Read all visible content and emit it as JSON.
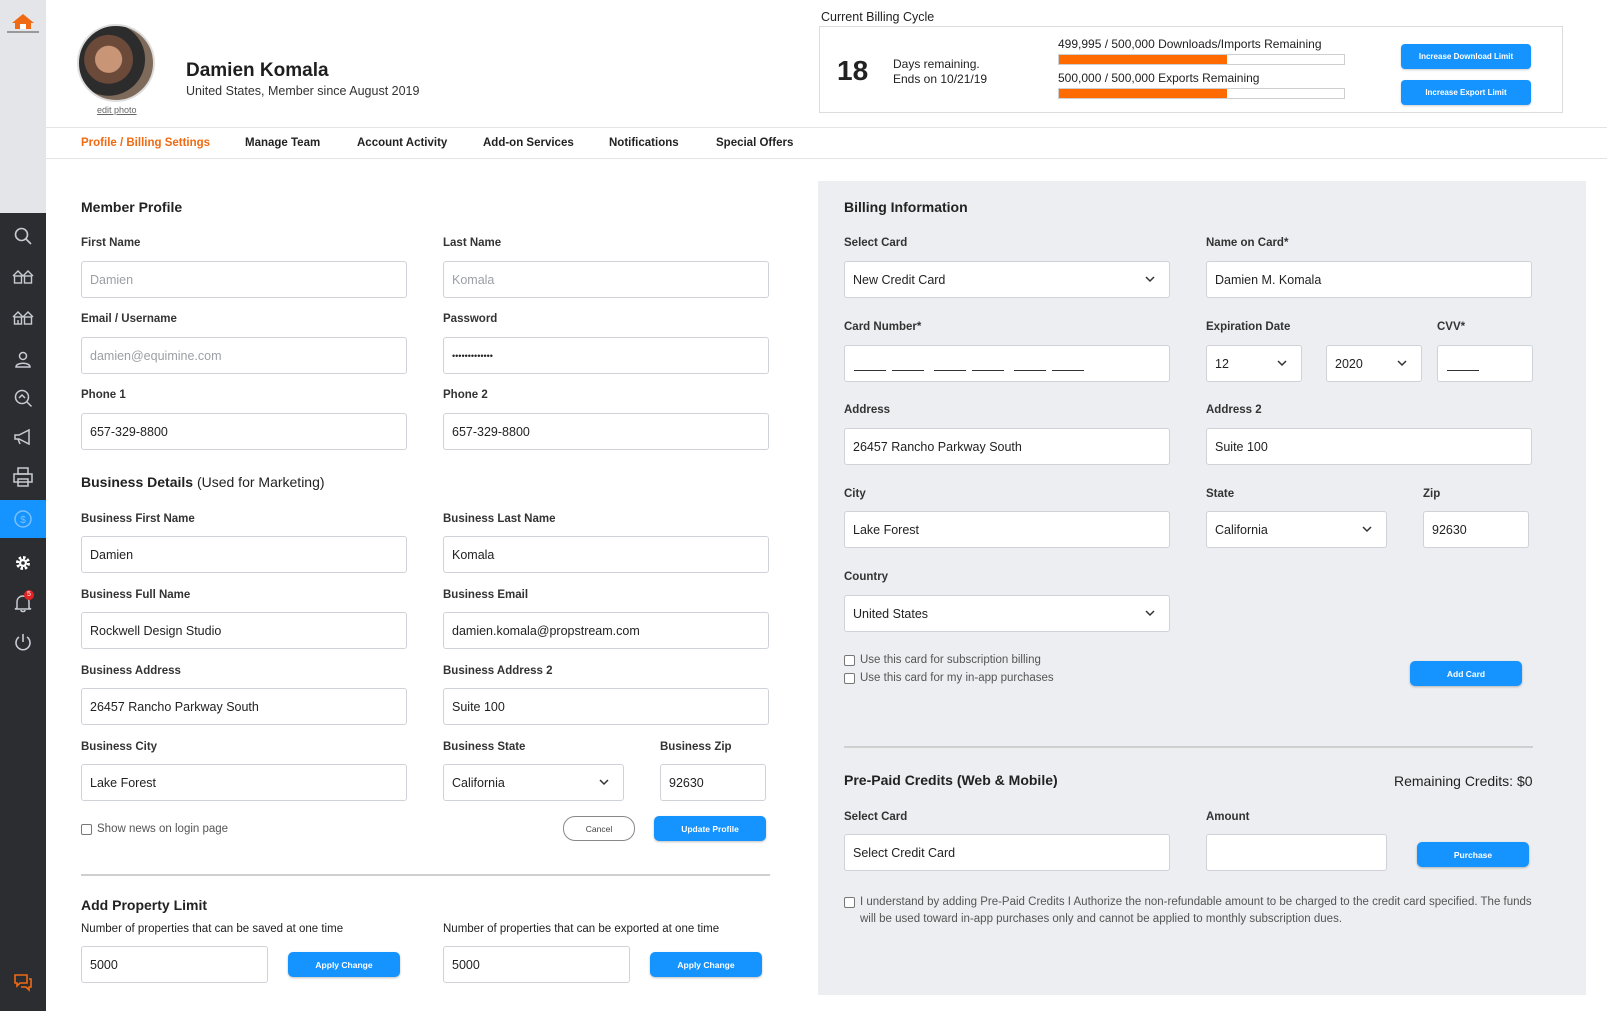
{
  "sidebar": {
    "icons": [
      "search-icon",
      "houses-icon",
      "houses-alt-icon",
      "user-icon",
      "search-property-icon",
      "megaphone-icon",
      "print-icon",
      "billing-icon",
      "gear-icon",
      "bell-icon",
      "power-icon",
      "chat-icon"
    ],
    "notification_count": "5"
  },
  "profile": {
    "name": "Damien Komala",
    "subtitle": "United States, Member since August 2019",
    "edit_photo": "edit photo"
  },
  "billing_cycle": {
    "title": "Current Billing Cycle",
    "days": "18",
    "days_line1": "Days remaining.",
    "days_line2": "Ends on 10/21/19",
    "downloads_label": "499,995 / 500,000 Downloads/Imports Remaining",
    "downloads_fraction": 0.59,
    "exports_label": "500,000 / 500,000 Exports Remaining",
    "exports_fraction": 0.59,
    "increase_download": "Increase Download Limit",
    "increase_export": "Increase Export Limit"
  },
  "tabs": [
    "Profile / Billing Settings",
    "Manage Team",
    "Account Activity",
    "Add-on Services",
    "Notifications",
    "Special Offers"
  ],
  "member_profile": {
    "title": "Member Profile",
    "first_name_label": "First Name",
    "first_name_placeholder": "Damien",
    "last_name_label": "Last Name",
    "last_name_placeholder": "Komala",
    "email_label": "Email / Username",
    "email_placeholder": "damien@equimine.com",
    "password_label": "Password",
    "password_value": "•••••••••••••",
    "phone1_label": "Phone 1",
    "phone1_value": "657-329-8800",
    "phone2_label": "Phone 2",
    "phone2_value": "657-329-8800"
  },
  "business": {
    "title": "Business Details",
    "title_suffix": " (Used for Marketing)",
    "first_name_label": "Business First Name",
    "first_name": "Damien",
    "last_name_label": "Business Last Name",
    "last_name": "Komala",
    "full_name_label": "Business Full Name",
    "full_name": "Rockwell Design Studio",
    "email_label": "Business Email",
    "email": "damien.komala@propstream.com",
    "address_label": "Business Address",
    "address": "26457 Rancho Parkway South",
    "address2_label": "Business Address 2",
    "address2": "Suite 100",
    "city_label": "Business City",
    "city": "Lake Forest",
    "state_label": "Business State",
    "state": "California",
    "zip_label": "Business Zip",
    "zip": "92630",
    "show_news": "Show news on login page",
    "cancel": "Cancel",
    "update": "Update Profile"
  },
  "property_limit": {
    "title": "Add Property Limit",
    "saved_label": "Number of properties that can be saved at one time",
    "saved_value": "5000",
    "exported_label": "Number of properties that can be exported at one time",
    "exported_value": "5000",
    "apply": "Apply Change"
  },
  "billing_info": {
    "title": "Billing Information",
    "select_card_label": "Select Card",
    "select_card_value": "New Credit Card",
    "name_on_card_label": "Name on Card*",
    "name_on_card": "Damien M. Komala",
    "card_number_label": "Card Number*",
    "expiration_label": "Expiration Date",
    "exp_month": "12",
    "exp_year": "2020",
    "cvv_label": "CVV*",
    "address_label": "Address",
    "address": "26457 Rancho Parkway South",
    "address2_label": "Address 2",
    "address2": "Suite 100",
    "city_label": "City",
    "city": "Lake Forest",
    "state_label": "State",
    "state": "California",
    "zip_label": "Zip",
    "zip": "92630",
    "country_label": "Country",
    "country": "United States",
    "use_subscription": "Use this card for subscription billing",
    "use_inapp": "Use this card for my in-app purchases",
    "add_card": "Add Card"
  },
  "prepaid": {
    "title": "Pre-Paid Credits (Web & Mobile)",
    "remaining": "Remaining Credits: $0",
    "select_card_label": "Select Card",
    "select_card_value": "Select Credit Card",
    "amount_label": "Amount",
    "purchase": "Purchase",
    "disclaimer_line1": "I understand by adding Pre-Paid Credits I Authorize the non-refundable amount to be charged to the credit card specified. The funds",
    "disclaimer_line2": "will be used toward in-app purchases only and cannot be applied to monthly subscription dues."
  },
  "colors": {
    "accent_blue": "#1593ff",
    "accent_orange": "#ff6b00",
    "tab_active": "#ef6a13",
    "sidebar_dark": "#2b2d31"
  }
}
